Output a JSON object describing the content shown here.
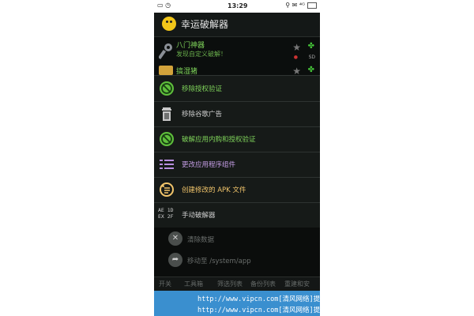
{
  "status": {
    "time": "13:29",
    "left_icons": "▭ ◷",
    "right_icons": "⚲ ✉ ⁴ᴳ"
  },
  "app": {
    "title": "幸运破解器"
  },
  "apps": [
    {
      "name": "八门神器",
      "desc": "发现自定义破解！",
      "badge": "SD"
    },
    {
      "name": "搞湿猪"
    }
  ],
  "menu": [
    {
      "label": "移除授权验证",
      "color": "#7fd35a"
    },
    {
      "label": "移除谷歌广告",
      "color": "#cfcfcf"
    },
    {
      "label": "破解应用内购和授权验证",
      "color": "#7fd35a"
    },
    {
      "label": "更改应用程序组件",
      "color": "#c59ee6"
    },
    {
      "label": "创建修改的 APK 文件",
      "color": "#f2c56b"
    },
    {
      "label": "手动破解器",
      "color": "#cfcfcf",
      "icon_text_1": "AE 1D",
      "icon_text_2": "EX 2F"
    }
  ],
  "dimmed": [
    {
      "label": "清除数据",
      "icon": "✕"
    },
    {
      "label": "移动至 /system/app",
      "icon": "➦"
    }
  ],
  "tabs": [
    "开关",
    "工具箱",
    "筛选列表",
    "备份列表",
    "重建和安"
  ],
  "watermark": [
    "http://www.vipcn.com[清风网络]提供",
    "http://www.vipcn.com[清风网络]提供"
  ]
}
